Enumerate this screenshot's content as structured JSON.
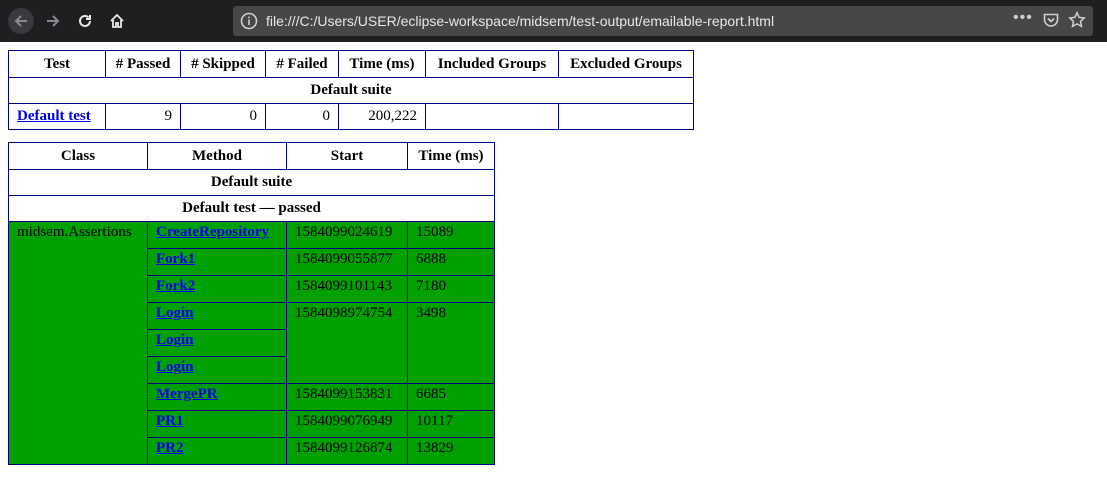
{
  "browser": {
    "url": "file:///C:/Users/USER/eclipse-workspace/midsem/test-output/emailable-report.html",
    "icons": [
      "back-icon",
      "forward-icon",
      "reload-icon",
      "home-icon",
      "info-icon",
      "more-icon",
      "pocket-icon",
      "star-icon"
    ],
    "more_label": "•••"
  },
  "summary": {
    "headers": [
      "Test",
      "# Passed",
      "# Skipped",
      "# Failed",
      "Time (ms)",
      "Included Groups",
      "Excluded Groups"
    ],
    "suite": "Default suite",
    "row": {
      "test": "Default test",
      "passed": "9",
      "skipped": "0",
      "failed": "0",
      "time": "200,222",
      "included": "",
      "excluded": ""
    }
  },
  "methods": {
    "headers": [
      "Class",
      "Method",
      "Start",
      "Time (ms)"
    ],
    "suite": "Default suite",
    "test_status": "Default test — passed",
    "class_name": "midsem.Assertions",
    "rows": [
      {
        "method": "CreateRepository",
        "start": "1584099024619",
        "time": "15089"
      },
      {
        "method": "Fork1",
        "start": "1584099055877",
        "time": "6888"
      },
      {
        "method": "Fork2",
        "start": "1584099101143",
        "time": "7180"
      },
      {
        "method": "Login",
        "start": "1584098974754",
        "time": "3498"
      },
      {
        "method": "Login"
      },
      {
        "method": "Login"
      },
      {
        "method": "MergePR",
        "start": "1584099153831",
        "time": "6685"
      },
      {
        "method": "PR1",
        "start": "1584099076949",
        "time": "10117"
      },
      {
        "method": "PR2",
        "start": "1584099126874",
        "time": "13829"
      }
    ],
    "pass_color": "#00a000"
  }
}
